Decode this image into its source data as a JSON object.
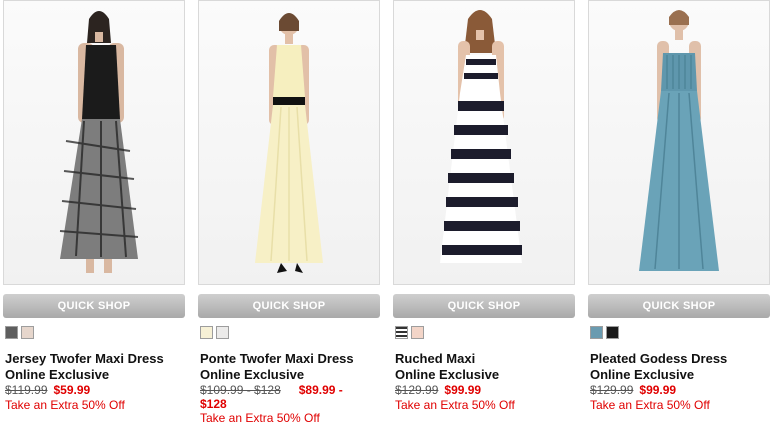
{
  "quick_shop_label": "QUICK SHOP",
  "products": [
    {
      "name": "Jersey Twofer Maxi Dress",
      "exclusive": "Online Exclusive",
      "orig_price": "$119.99",
      "sale_price": "$59.99",
      "promo": "Take an Extra 50% Off",
      "swatches": [
        "#5e5e5e",
        "#e6d6cc"
      ]
    },
    {
      "name": "Ponte Twofer Maxi Dress",
      "exclusive": "Online Exclusive",
      "orig_price": "$109.99 - $128",
      "sale_price": "$89.99 -",
      "sale_price_cont": "$128",
      "promo": "Take an Extra 50% Off",
      "swatches": [
        "#f7f1d6",
        "#ecebea"
      ]
    },
    {
      "name": "Ruched Maxi",
      "exclusive": "Online Exclusive",
      "orig_price": "$129.99",
      "sale_price": "$99.99",
      "promo": "Take an Extra 50% Off",
      "swatches": [
        "#9a9a9a",
        "#f3d5c8"
      ]
    },
    {
      "name": "Pleated Godess Dress",
      "exclusive": "Online Exclusive",
      "orig_price": "$129.99",
      "sale_price": "$99.99",
      "promo": "Take an Extra 50% Off",
      "swatches": [
        "#6a9bb0",
        "#1a1a1a"
      ]
    }
  ]
}
